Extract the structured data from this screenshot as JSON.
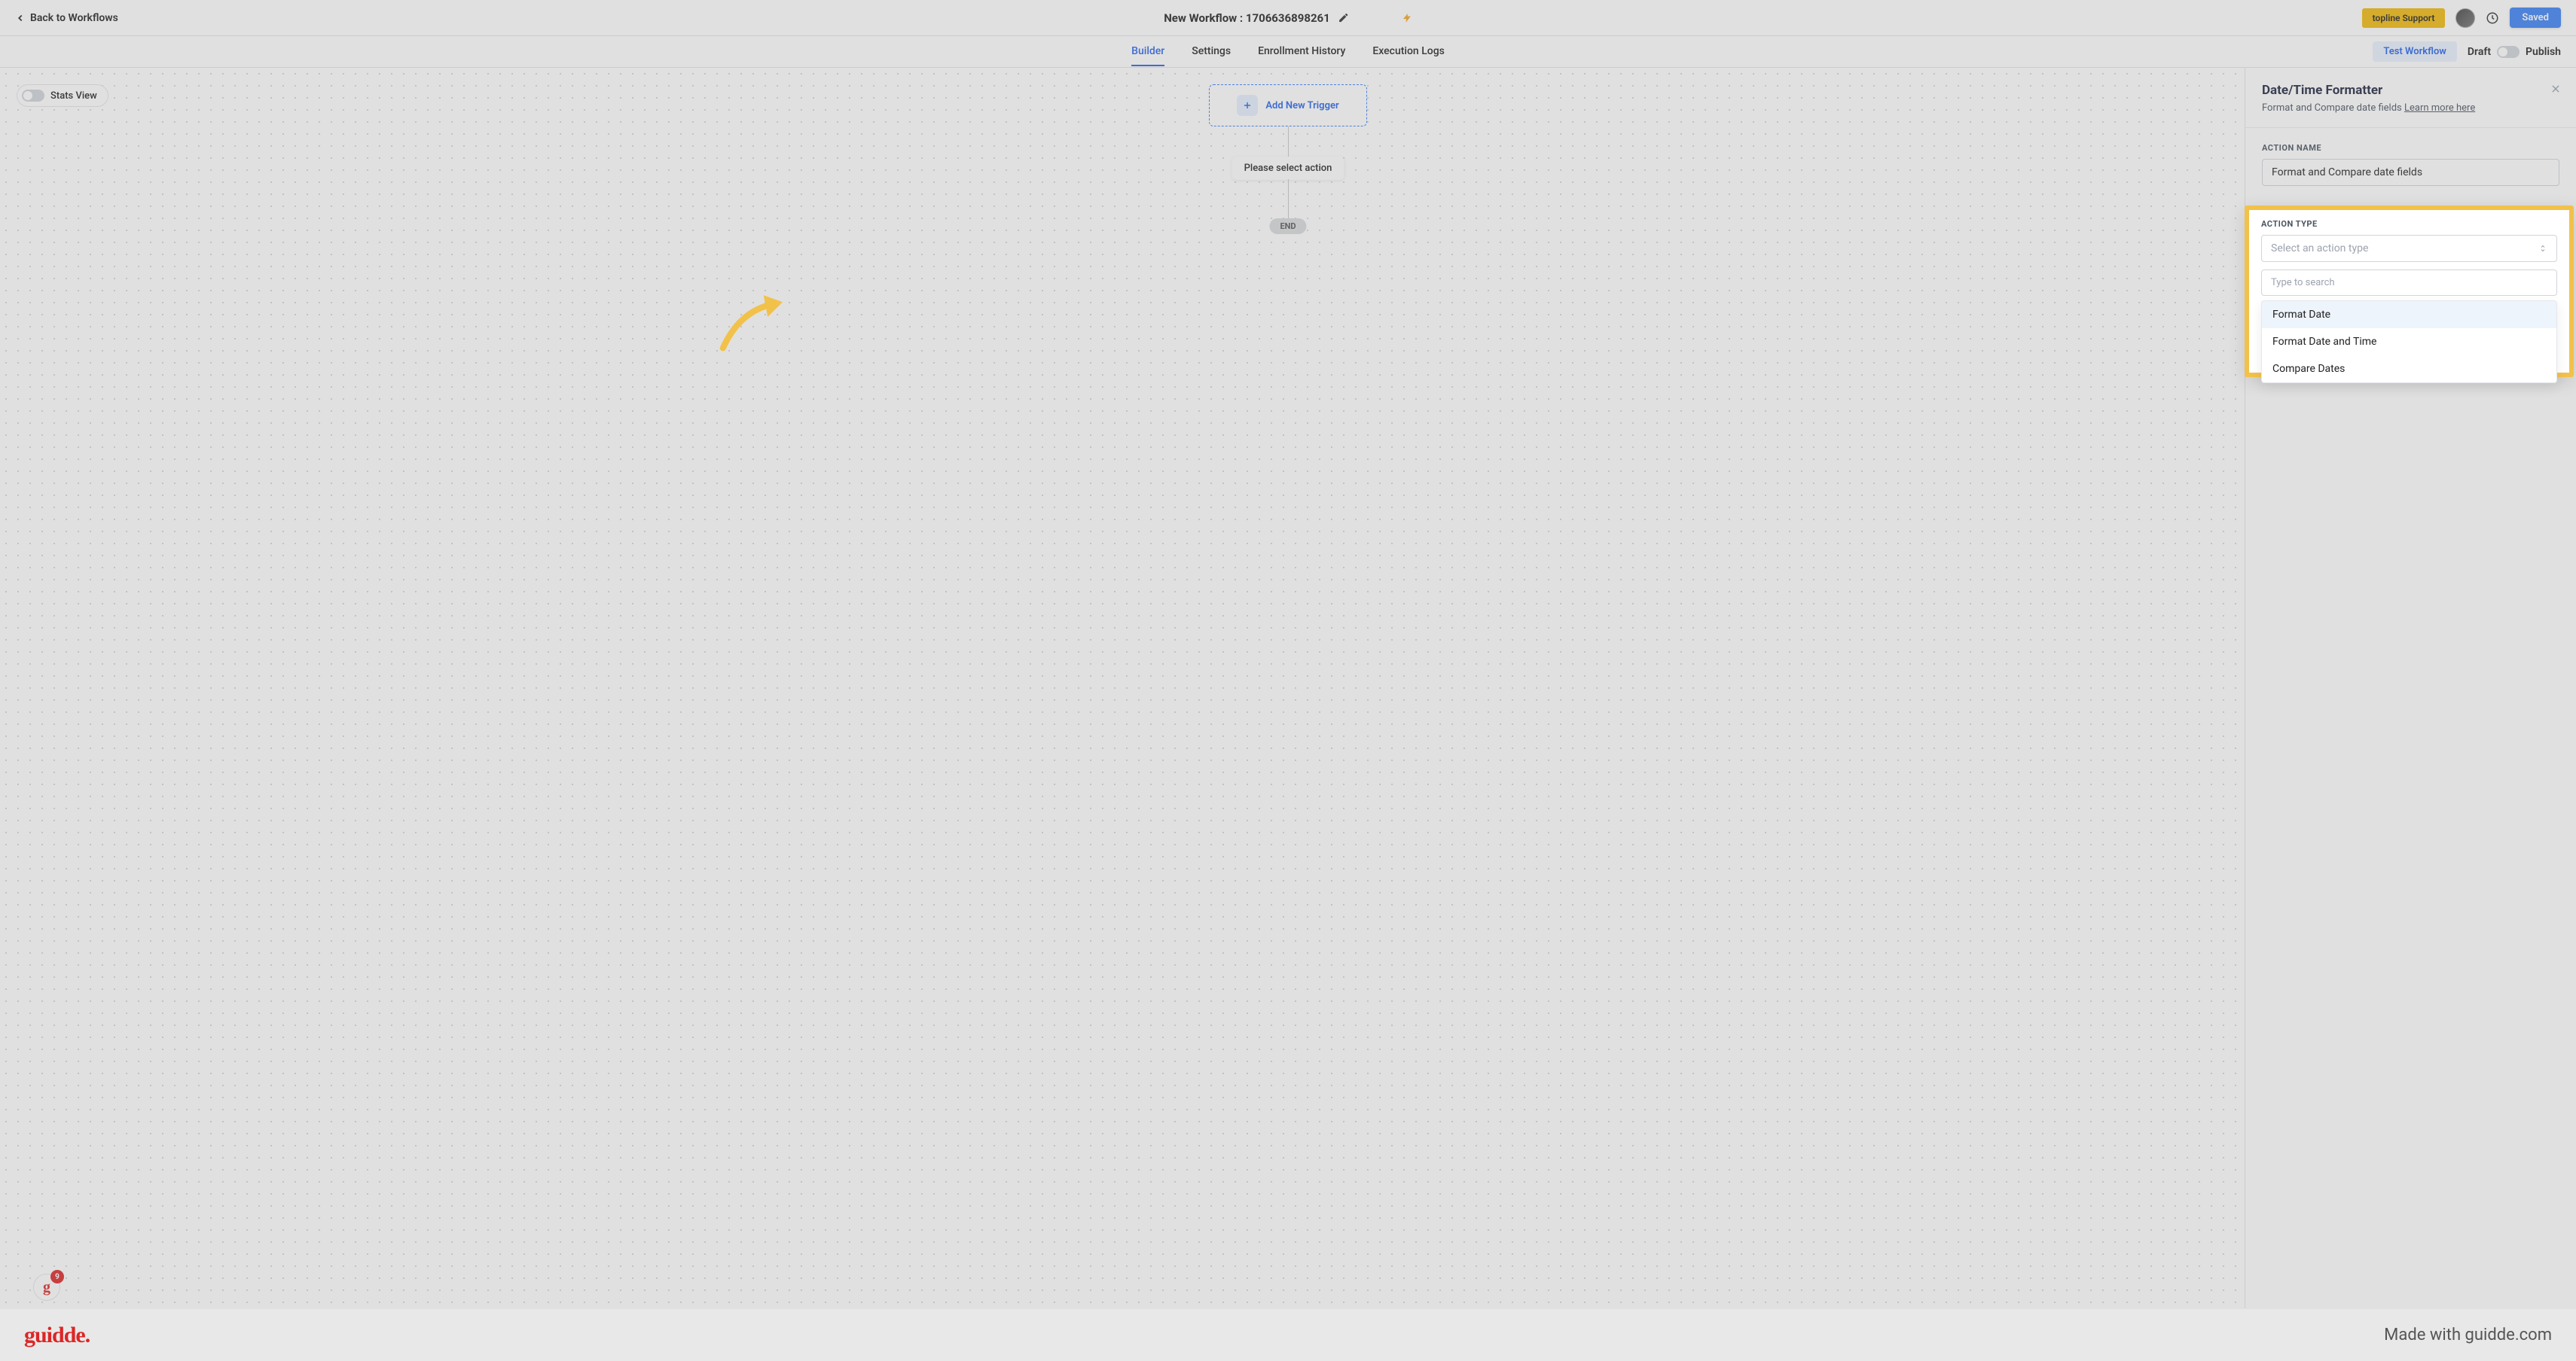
{
  "header": {
    "back_label": "Back to Workflows",
    "title": "New Workflow : 1706636898261",
    "support_label": "topline Support",
    "saved_label": "Saved"
  },
  "tabs": {
    "items": [
      "Builder",
      "Settings",
      "Enrollment History",
      "Execution Logs"
    ],
    "active_index": 0,
    "test_label": "Test Workflow",
    "draft_label": "Draft",
    "publish_label": "Publish"
  },
  "canvas": {
    "stats_view_label": "Stats View",
    "trigger_label": "Add New Trigger",
    "action_node_label": "Please select action",
    "end_label": "END",
    "badge_count": "9"
  },
  "panel": {
    "title": "Date/Time Formatter",
    "subtitle": "Format and Compare date fields ",
    "learn_more": "Learn more here",
    "action_name_label": "ACTION NAME",
    "action_name_value": "Format and Compare date fields",
    "action_type_label": "ACTION TYPE",
    "action_type_placeholder": "Select an action type",
    "search_placeholder": "Type to search",
    "options": [
      "Format Date",
      "Format Date and Time",
      "Compare Dates"
    ],
    "highlighted_index": 0
  },
  "footer": {
    "logo_text": "guidde.",
    "made_with": "Made with guidde.com"
  }
}
